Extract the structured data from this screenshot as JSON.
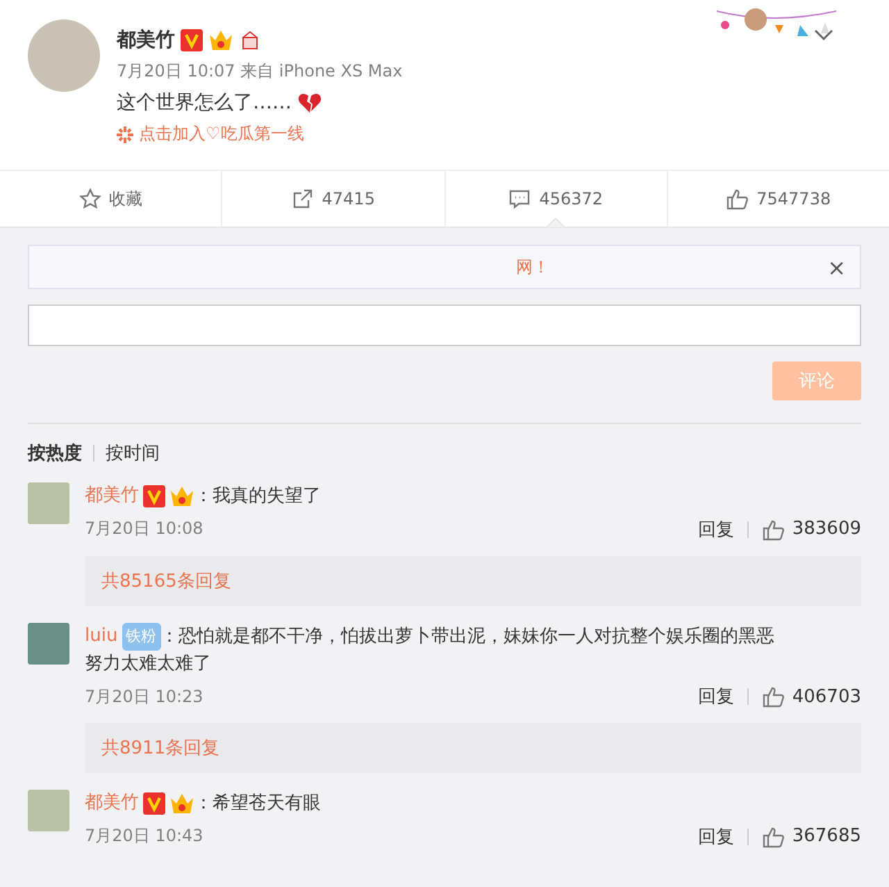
{
  "post": {
    "author": "都美竹",
    "time": "7月20日 10:07 来自 iPhone XS Max",
    "text": "这个世界怎么了……",
    "topic": "点击加入♡吃瓜第一线"
  },
  "actions": [
    {
      "kind": "star",
      "label": "收藏"
    },
    {
      "kind": "share",
      "label": "47415"
    },
    {
      "kind": "comment",
      "label": "456372",
      "selected": true
    },
    {
      "kind": "like",
      "label": "7547738"
    }
  ],
  "notice": {
    "text": "网！",
    "close": "×"
  },
  "submit": "评论",
  "sort_tabs": [
    {
      "label": "按热度",
      "selected": true
    },
    {
      "label": "按时间",
      "selected": false
    }
  ],
  "comments": [
    {
      "author": "都美竹",
      "verified": true,
      "text": "：我真的失望了",
      "time": "7月20日 10:08",
      "reply": "回复",
      "likes": "383609",
      "replies": "共85165条回复"
    },
    {
      "author": "luiu",
      "verified": false,
      "badge": "铁粉",
      "text": "：恐怕就是都不干净，怕拔出萝卜带出泥，妹妹你一人对抗整个娱乐圈的黑恶",
      "continuation": "努力太难太难了",
      "time": "7月20日 10:23",
      "reply": "回复",
      "likes": "406703",
      "replies": "共8911条回复"
    },
    {
      "author": "都美竹",
      "verified": true,
      "text": "：希望苍天有眼",
      "time": "7月20日 10:43",
      "reply": "回复",
      "likes": "367685"
    }
  ]
}
